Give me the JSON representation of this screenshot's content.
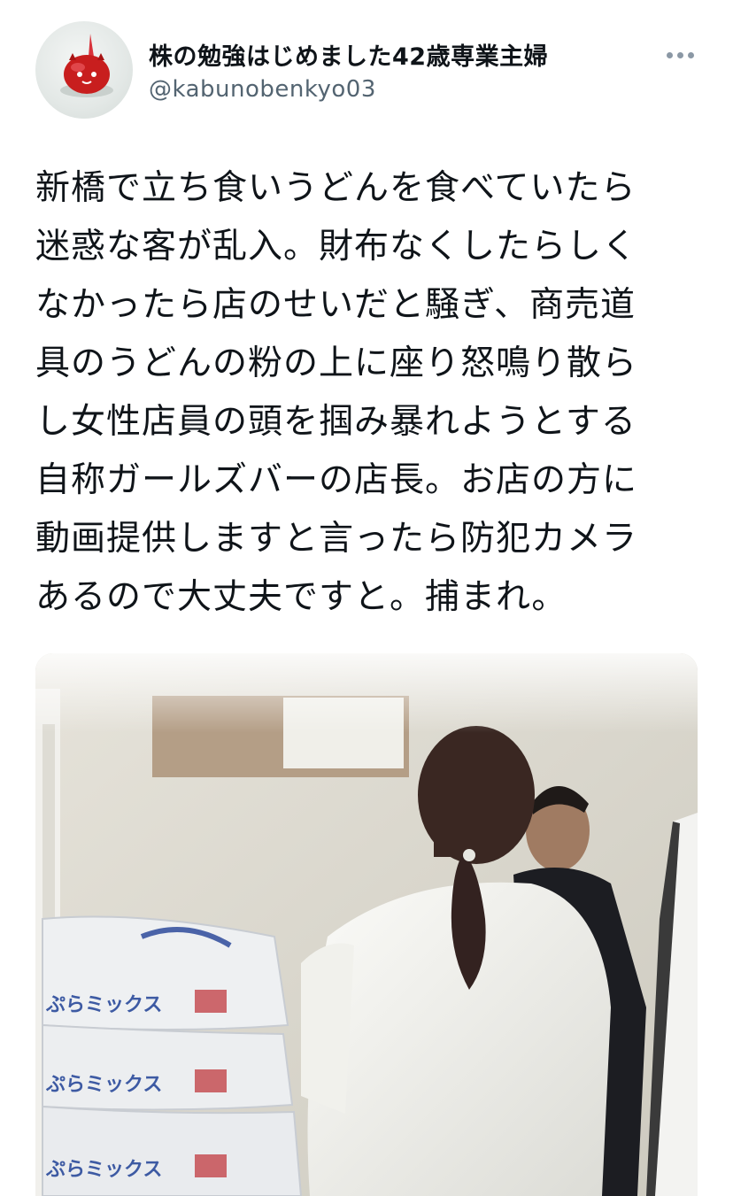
{
  "tweet": {
    "author": {
      "display_name": "株の勉強はじめました42歳専業主婦",
      "handle": "@kabunobenkyo03",
      "avatar_icon": "red-character-avatar-icon"
    },
    "more_icon": "more-horizontal-icon",
    "text_lines": [
      "新橋で立ち食いうどんを食べていたら",
      "迷惑な客が乱入。財布なくしたらしく",
      "なかったら店のせいだと騒ぎ、商売道",
      "具のうどんの粉の上に座り怒鳴り散ら",
      "し女性店員の頭を掴み暴れようとする",
      "自称ガールズバーの店長。お店の方に",
      "動画提供しますと言ったら防犯カメラ",
      "あるので大丈夫ですと。捕まれ。"
    ],
    "media": {
      "bag_labels": [
        "ぷらミックス",
        "ぷらミックス",
        "ぷらミックス"
      ]
    }
  },
  "colors": {
    "text": "#0f1419",
    "secondary_text": "#536471",
    "avatar_red": "#c81e1e"
  }
}
